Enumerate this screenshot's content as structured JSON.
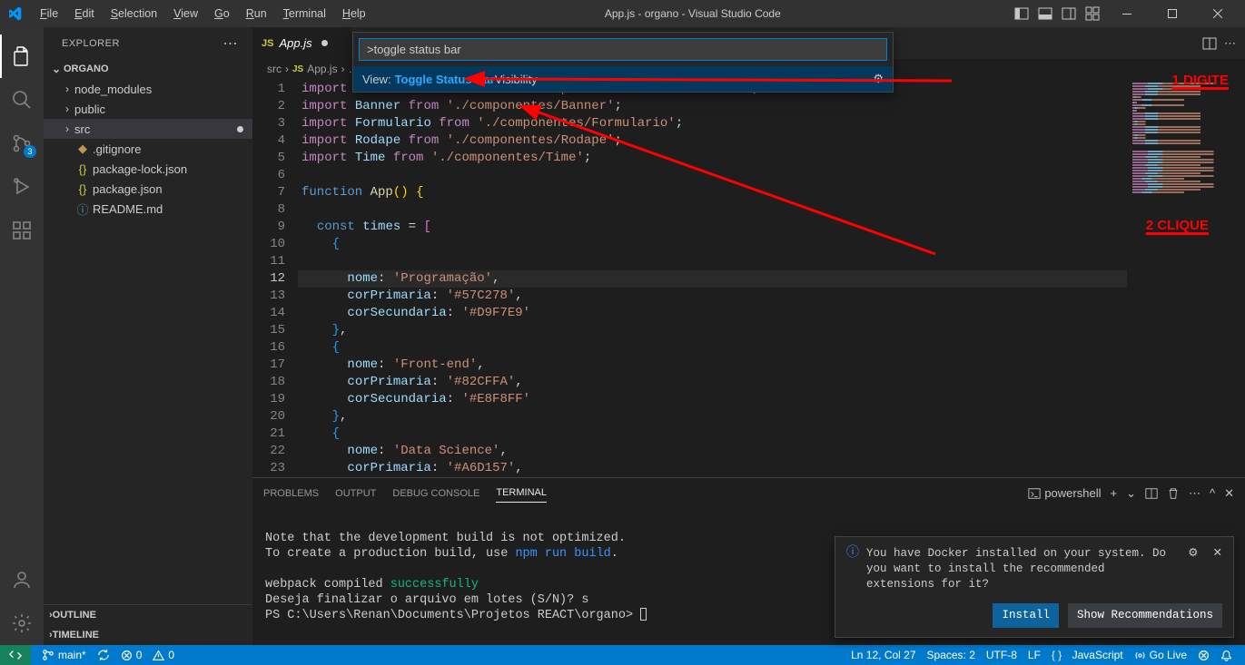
{
  "title": "App.js - organo - Visual Studio Code",
  "menu": [
    "File",
    "Edit",
    "Selection",
    "View",
    "Go",
    "Run",
    "Terminal",
    "Help"
  ],
  "sidebar": {
    "header": "EXPLORER",
    "root": "ORGANO",
    "items": [
      {
        "label": "node_modules",
        "type": "folder"
      },
      {
        "label": "public",
        "type": "folder"
      },
      {
        "label": "src",
        "type": "folder",
        "selected": true,
        "modified": true
      },
      {
        "label": ".gitignore",
        "type": "git"
      },
      {
        "label": "package-lock.json",
        "type": "json"
      },
      {
        "label": "package.json",
        "type": "json"
      },
      {
        "label": "README.md",
        "type": "info"
      }
    ],
    "outline": "OUTLINE",
    "timeline": "TIMELINE"
  },
  "scm_badge": "3",
  "tab": {
    "label": "App.js"
  },
  "breadcrumb": [
    "src",
    "App.js"
  ],
  "palette": {
    "input": ">toggle status bar",
    "item_pre": "View: ",
    "item_match": "Toggle Status Bar",
    "item_post": " Visibility"
  },
  "annotations": {
    "a1": "1 DIGITE",
    "a2": "2 CLIQUE"
  },
  "code": {
    "lines": [
      "import CardColaborador from './componentes/CardColaborador';",
      "import Banner from './componentes/Banner';",
      "import Formulario from './componentes/Formulario';",
      "import Rodape from './componentes/Rodape';",
      "import Time from './componentes/Time';",
      "",
      "function App() {",
      "",
      "  const times = [",
      "    {",
      "",
      "      nome: 'Programação',",
      "      corPrimaria: '#57C278',",
      "      corSecundaria: '#D9F7E9'",
      "    },",
      "    {",
      "      nome: 'Front-end',",
      "      corPrimaria: '#82CFFA',",
      "      corSecundaria: '#E8F8FF'",
      "    },",
      "    {",
      "      nome: 'Data Science',",
      "      corPrimaria: '#A6D157',"
    ],
    "highlight_index": 11
  },
  "panel": {
    "tabs": [
      "PROBLEMS",
      "OUTPUT",
      "DEBUG CONSOLE",
      "TERMINAL"
    ],
    "active": 3,
    "shell": "powershell",
    "note1": "Note that the development build is not optimized.",
    "note2a": "To create a production build, use ",
    "note2b": "npm run build",
    "note2c": ".",
    "compiled_a": "webpack compiled ",
    "compiled_b": "successfully",
    "batch": "Deseja finalizar o arquivo em lotes (S/N)? s",
    "prompt": "PS C:\\Users\\Renan\\Documents\\Projetos REACT\\organo> "
  },
  "toast": {
    "msg": "You have Docker installed on your system. Do you want to install the recommended extensions for it?",
    "install": "Install",
    "show": "Show Recommendations"
  },
  "status": {
    "branch": "main*",
    "sync": "",
    "errors": "0",
    "warnings": "0",
    "lncol": "Ln 12, Col 27",
    "spaces": "Spaces: 2",
    "encoding": "UTF-8",
    "eol": "LF",
    "lang": "JavaScript",
    "golive": "Go Live"
  }
}
